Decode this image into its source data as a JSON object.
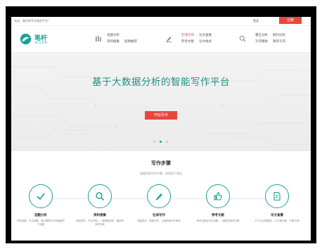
{
  "topbar": {
    "welcome": "欢迎，笔杆网写作服务平台！",
    "login": "登录",
    "register": "注册"
  },
  "logo": {
    "name": "笔杆",
    "sub": "BIGAN"
  },
  "nav": {
    "group1": [
      "选题分析",
      "资料搜集",
      "提纲推荐"
    ],
    "group2": [
      "在线写作",
      "参考文献",
      "论文查重",
      "论文格式"
    ],
    "group3": [
      "署全分析",
      "写作模板",
      "期刊分析",
      "我的写作"
    ]
  },
  "hero": {
    "headline": "基于大数据分析的智能写作平台",
    "cta": "开始写作"
  },
  "steps": {
    "title": "写作步骤",
    "subtitle": "根据常规写作步骤，给您如下建议",
    "items": [
      {
        "label": "选题分析",
        "desc": "科研话题，论文选题，简可图帮引分析最新热门话题"
      },
      {
        "label": "资料搜集",
        "desc": "查阅资料，专业导师，一键收集资料，最好的参考文献"
      },
      {
        "label": "在线写作",
        "desc": "智能提示，智能写作，云端快速写作体验"
      },
      {
        "label": "参考文献",
        "desc": "参考文献自动生成器，一键规范参考文献"
      },
      {
        "label": "论文查重",
        "desc": "10个比对数据库，15亿篇文献，只需30秒"
      }
    ]
  },
  "colors": {
    "accent": "#1aa197",
    "brand_red": "#e8463f"
  }
}
